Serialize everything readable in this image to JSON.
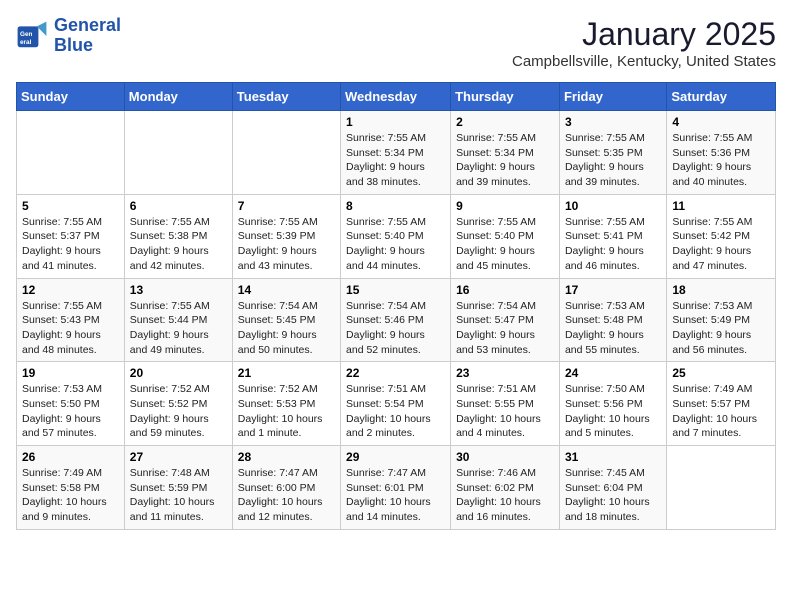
{
  "logo": {
    "line1": "General",
    "line2": "Blue"
  },
  "title": "January 2025",
  "location": "Campbellsville, Kentucky, United States",
  "headers": [
    "Sunday",
    "Monday",
    "Tuesday",
    "Wednesday",
    "Thursday",
    "Friday",
    "Saturday"
  ],
  "weeks": [
    [
      {
        "day": "",
        "sunrise": "",
        "sunset": "",
        "daylight": ""
      },
      {
        "day": "",
        "sunrise": "",
        "sunset": "",
        "daylight": ""
      },
      {
        "day": "",
        "sunrise": "",
        "sunset": "",
        "daylight": ""
      },
      {
        "day": "1",
        "sunrise": "Sunrise: 7:55 AM",
        "sunset": "Sunset: 5:34 PM",
        "daylight": "Daylight: 9 hours and 38 minutes."
      },
      {
        "day": "2",
        "sunrise": "Sunrise: 7:55 AM",
        "sunset": "Sunset: 5:34 PM",
        "daylight": "Daylight: 9 hours and 39 minutes."
      },
      {
        "day": "3",
        "sunrise": "Sunrise: 7:55 AM",
        "sunset": "Sunset: 5:35 PM",
        "daylight": "Daylight: 9 hours and 39 minutes."
      },
      {
        "day": "4",
        "sunrise": "Sunrise: 7:55 AM",
        "sunset": "Sunset: 5:36 PM",
        "daylight": "Daylight: 9 hours and 40 minutes."
      }
    ],
    [
      {
        "day": "5",
        "sunrise": "Sunrise: 7:55 AM",
        "sunset": "Sunset: 5:37 PM",
        "daylight": "Daylight: 9 hours and 41 minutes."
      },
      {
        "day": "6",
        "sunrise": "Sunrise: 7:55 AM",
        "sunset": "Sunset: 5:38 PM",
        "daylight": "Daylight: 9 hours and 42 minutes."
      },
      {
        "day": "7",
        "sunrise": "Sunrise: 7:55 AM",
        "sunset": "Sunset: 5:39 PM",
        "daylight": "Daylight: 9 hours and 43 minutes."
      },
      {
        "day": "8",
        "sunrise": "Sunrise: 7:55 AM",
        "sunset": "Sunset: 5:40 PM",
        "daylight": "Daylight: 9 hours and 44 minutes."
      },
      {
        "day": "9",
        "sunrise": "Sunrise: 7:55 AM",
        "sunset": "Sunset: 5:40 PM",
        "daylight": "Daylight: 9 hours and 45 minutes."
      },
      {
        "day": "10",
        "sunrise": "Sunrise: 7:55 AM",
        "sunset": "Sunset: 5:41 PM",
        "daylight": "Daylight: 9 hours and 46 minutes."
      },
      {
        "day": "11",
        "sunrise": "Sunrise: 7:55 AM",
        "sunset": "Sunset: 5:42 PM",
        "daylight": "Daylight: 9 hours and 47 minutes."
      }
    ],
    [
      {
        "day": "12",
        "sunrise": "Sunrise: 7:55 AM",
        "sunset": "Sunset: 5:43 PM",
        "daylight": "Daylight: 9 hours and 48 minutes."
      },
      {
        "day": "13",
        "sunrise": "Sunrise: 7:55 AM",
        "sunset": "Sunset: 5:44 PM",
        "daylight": "Daylight: 9 hours and 49 minutes."
      },
      {
        "day": "14",
        "sunrise": "Sunrise: 7:54 AM",
        "sunset": "Sunset: 5:45 PM",
        "daylight": "Daylight: 9 hours and 50 minutes."
      },
      {
        "day": "15",
        "sunrise": "Sunrise: 7:54 AM",
        "sunset": "Sunset: 5:46 PM",
        "daylight": "Daylight: 9 hours and 52 minutes."
      },
      {
        "day": "16",
        "sunrise": "Sunrise: 7:54 AM",
        "sunset": "Sunset: 5:47 PM",
        "daylight": "Daylight: 9 hours and 53 minutes."
      },
      {
        "day": "17",
        "sunrise": "Sunrise: 7:53 AM",
        "sunset": "Sunset: 5:48 PM",
        "daylight": "Daylight: 9 hours and 55 minutes."
      },
      {
        "day": "18",
        "sunrise": "Sunrise: 7:53 AM",
        "sunset": "Sunset: 5:49 PM",
        "daylight": "Daylight: 9 hours and 56 minutes."
      }
    ],
    [
      {
        "day": "19",
        "sunrise": "Sunrise: 7:53 AM",
        "sunset": "Sunset: 5:50 PM",
        "daylight": "Daylight: 9 hours and 57 minutes."
      },
      {
        "day": "20",
        "sunrise": "Sunrise: 7:52 AM",
        "sunset": "Sunset: 5:52 PM",
        "daylight": "Daylight: 9 hours and 59 minutes."
      },
      {
        "day": "21",
        "sunrise": "Sunrise: 7:52 AM",
        "sunset": "Sunset: 5:53 PM",
        "daylight": "Daylight: 10 hours and 1 minute."
      },
      {
        "day": "22",
        "sunrise": "Sunrise: 7:51 AM",
        "sunset": "Sunset: 5:54 PM",
        "daylight": "Daylight: 10 hours and 2 minutes."
      },
      {
        "day": "23",
        "sunrise": "Sunrise: 7:51 AM",
        "sunset": "Sunset: 5:55 PM",
        "daylight": "Daylight: 10 hours and 4 minutes."
      },
      {
        "day": "24",
        "sunrise": "Sunrise: 7:50 AM",
        "sunset": "Sunset: 5:56 PM",
        "daylight": "Daylight: 10 hours and 5 minutes."
      },
      {
        "day": "25",
        "sunrise": "Sunrise: 7:49 AM",
        "sunset": "Sunset: 5:57 PM",
        "daylight": "Daylight: 10 hours and 7 minutes."
      }
    ],
    [
      {
        "day": "26",
        "sunrise": "Sunrise: 7:49 AM",
        "sunset": "Sunset: 5:58 PM",
        "daylight": "Daylight: 10 hours and 9 minutes."
      },
      {
        "day": "27",
        "sunrise": "Sunrise: 7:48 AM",
        "sunset": "Sunset: 5:59 PM",
        "daylight": "Daylight: 10 hours and 11 minutes."
      },
      {
        "day": "28",
        "sunrise": "Sunrise: 7:47 AM",
        "sunset": "Sunset: 6:00 PM",
        "daylight": "Daylight: 10 hours and 12 minutes."
      },
      {
        "day": "29",
        "sunrise": "Sunrise: 7:47 AM",
        "sunset": "Sunset: 6:01 PM",
        "daylight": "Daylight: 10 hours and 14 minutes."
      },
      {
        "day": "30",
        "sunrise": "Sunrise: 7:46 AM",
        "sunset": "Sunset: 6:02 PM",
        "daylight": "Daylight: 10 hours and 16 minutes."
      },
      {
        "day": "31",
        "sunrise": "Sunrise: 7:45 AM",
        "sunset": "Sunset: 6:04 PM",
        "daylight": "Daylight: 10 hours and 18 minutes."
      },
      {
        "day": "",
        "sunrise": "",
        "sunset": "",
        "daylight": ""
      }
    ]
  ]
}
